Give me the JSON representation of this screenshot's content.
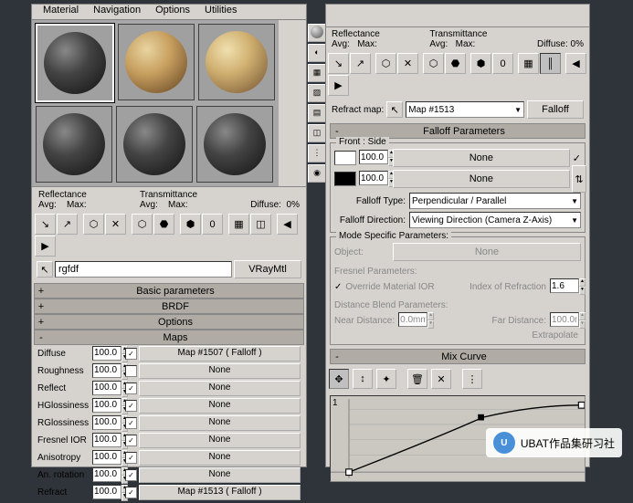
{
  "menubar": {
    "material": "Material",
    "navigation": "Navigation",
    "options": "Options",
    "utilities": "Utilities"
  },
  "reflectance": {
    "title": "Reflectance",
    "avg": "Avg:",
    "max": "Max:"
  },
  "transmittance": {
    "title": "Transmittance",
    "avg": "Avg:",
    "max": "Max:"
  },
  "diffuse_label": "Diffuse:",
  "diffuse_pct": "0%",
  "material_name": "rgfdf",
  "material_type": "VRayMtl",
  "rollouts": {
    "basic": "Basic parameters",
    "brdf": "BRDF",
    "options": "Options",
    "maps": "Maps"
  },
  "maps": {
    "diffuse": {
      "label": "Diffuse",
      "amount": "100.0",
      "slot": "Map #1507  ( Falloff )"
    },
    "roughness": {
      "label": "Roughness",
      "amount": "100.0",
      "slot": "None"
    },
    "reflect": {
      "label": "Reflect",
      "amount": "100.0",
      "slot": "None"
    },
    "hgloss": {
      "label": "HGlossiness",
      "amount": "100.0",
      "slot": "None"
    },
    "rgloss": {
      "label": "RGlossiness",
      "amount": "100.0",
      "slot": "None"
    },
    "fresnel": {
      "label": "Fresnel IOR",
      "amount": "100.0",
      "slot": "None"
    },
    "aniso": {
      "label": "Anisotropy",
      "amount": "100.0",
      "slot": "None"
    },
    "anrot": {
      "label": "An. rotation",
      "amount": "100.0",
      "slot": "None"
    },
    "refract": {
      "label": "Refract",
      "amount": "100.0",
      "slot": "Map #1513  ( Falloff )"
    }
  },
  "right": {
    "refract_map_label": "Refract map:",
    "refract_map": "Map #1513",
    "falloff_btn": "Falloff",
    "falloff_params": "Falloff Parameters",
    "front_side": "Front : Side",
    "val1": "100.0",
    "slot1": "None",
    "val2": "100.0",
    "slot2": "None",
    "falloff_type_label": "Falloff Type:",
    "falloff_type": "Perpendicular / Parallel",
    "falloff_dir_label": "Falloff Direction:",
    "falloff_dir": "Viewing Direction (Camera Z-Axis)",
    "mode_params": "Mode Specific Parameters:",
    "object_label": "Object:",
    "object_val": "None",
    "fresnel_params": "Fresnel Parameters:",
    "override": "Override Material IOR",
    "ior_label": "Index of Refraction",
    "ior_val": "1.6",
    "dist_params": "Distance Blend Parameters:",
    "near_label": "Near Distance:",
    "near_val": "0.0mm",
    "far_label": "Far Distance:",
    "far_val": "100.0mm",
    "extrapolate": "Extrapolate",
    "mix_curve": "Mix Curve",
    "curve_y": "1"
  },
  "watermark": "UBAT作品集研习社"
}
